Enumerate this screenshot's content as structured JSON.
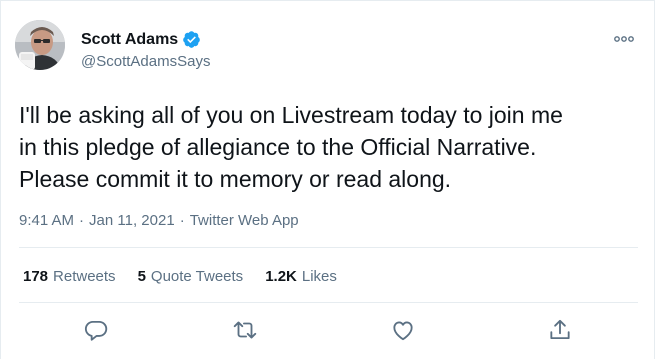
{
  "author": {
    "display_name": "Scott Adams",
    "handle": "@ScottAdamsSays",
    "verified": true,
    "avatar_icon": "profile-photo"
  },
  "tweet": {
    "text": "I'll be asking all of you on Livestream today to join me\nin this pledge of allegiance to the Official Narrative.\nPlease commit it to memory or read along."
  },
  "meta": {
    "time": "9:41 AM",
    "separator": "·",
    "date": "Jan 11, 2021",
    "source": "Twitter Web App"
  },
  "stats": [
    {
      "count": "178",
      "label": "Retweets"
    },
    {
      "count": "5",
      "label": "Quote Tweets"
    },
    {
      "count": "1.2K",
      "label": "Likes"
    }
  ],
  "actions": [
    "reply-icon",
    "retweet-icon",
    "like-icon",
    "share-icon"
  ],
  "colors": {
    "text": "#0f1419",
    "secondary": "#5b7083",
    "verified": "#1da1f2",
    "divider": "#e6ecf0"
  }
}
